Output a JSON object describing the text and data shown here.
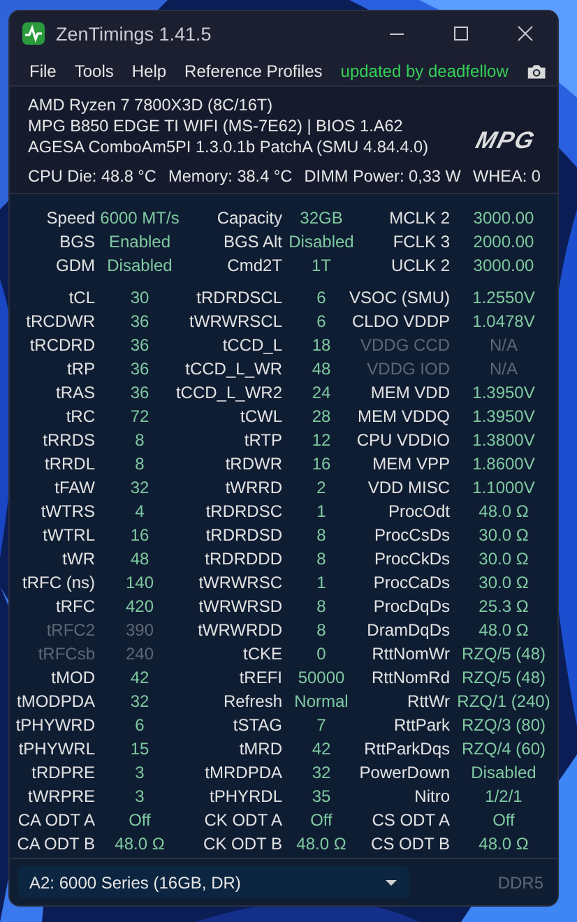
{
  "window": {
    "title": "ZenTimings 1.41.5"
  },
  "menu": {
    "items": [
      "File",
      "Tools",
      "Help",
      "Reference Profiles"
    ],
    "credit": "updated by deadfellow"
  },
  "system_info": {
    "lines": [
      "AMD Ryzen 7 7800X3D (8C/16T)",
      "MPG B850 EDGE TI WIFI (MS-7E62) | BIOS 1.A62",
      "AGESA ComboAm5PI 1.3.0.1b PatchA (SMU 4.84.4.0)"
    ],
    "logo_text": "MPG",
    "sensors": [
      "CPU Die: 48.8 °C",
      "Memory: 38.4 °C",
      "DIMM Power: 0,33 W",
      "WHEA: 0"
    ]
  },
  "summary_rows": [
    [
      {
        "label": "Speed",
        "value": "6000 MT/s",
        "disabled": false
      },
      {
        "label": "Capacity",
        "value": "32GB",
        "disabled": false
      },
      {
        "label": "MCLK  2",
        "value": "3000.00",
        "disabled": false
      }
    ],
    [
      {
        "label": "BGS",
        "value": "Enabled",
        "disabled": false
      },
      {
        "label": "BGS Alt",
        "value": "Disabled",
        "disabled": false
      },
      {
        "label": "FCLK  3",
        "value": "2000.00",
        "disabled": false
      }
    ],
    [
      {
        "label": "GDM",
        "value": "Disabled",
        "disabled": false
      },
      {
        "label": "Cmd2T",
        "value": "1T",
        "disabled": false
      },
      {
        "label": "UCLK  2",
        "value": "3000.00",
        "disabled": false
      }
    ]
  ],
  "timing_rows": [
    [
      {
        "label": "tCL",
        "value": "30",
        "disabled": false
      },
      {
        "label": "tRDRDSCL",
        "value": "6",
        "disabled": false
      },
      {
        "label": "VSOC (SMU)",
        "value": "1.2550V",
        "disabled": false
      }
    ],
    [
      {
        "label": "tRCDWR",
        "value": "36",
        "disabled": false
      },
      {
        "label": "tWRWRSCL",
        "value": "6",
        "disabled": false
      },
      {
        "label": "CLDO VDDP",
        "value": "1.0478V",
        "disabled": false
      }
    ],
    [
      {
        "label": "tRCDRD",
        "value": "36",
        "disabled": false
      },
      {
        "label": "tCCD_L",
        "value": "18",
        "disabled": false
      },
      {
        "label": "VDDG CCD",
        "value": "N/A",
        "disabled": true
      }
    ],
    [
      {
        "label": "tRP",
        "value": "36",
        "disabled": false
      },
      {
        "label": "tCCD_L_WR",
        "value": "48",
        "disabled": false
      },
      {
        "label": "VDDG IOD",
        "value": "N/A",
        "disabled": true
      }
    ],
    [
      {
        "label": "tRAS",
        "value": "36",
        "disabled": false
      },
      {
        "label": "tCCD_L_WR2",
        "value": "24",
        "disabled": false
      },
      {
        "label": "MEM VDD",
        "value": "1.3950V",
        "disabled": false
      }
    ],
    [
      {
        "label": "tRC",
        "value": "72",
        "disabled": false
      },
      {
        "label": "tCWL",
        "value": "28",
        "disabled": false
      },
      {
        "label": "MEM VDDQ",
        "value": "1.3950V",
        "disabled": false
      }
    ],
    [
      {
        "label": "tRRDS",
        "value": "8",
        "disabled": false
      },
      {
        "label": "tRTP",
        "value": "12",
        "disabled": false
      },
      {
        "label": "CPU VDDIO",
        "value": "1.3800V",
        "disabled": false
      }
    ],
    [
      {
        "label": "tRRDL",
        "value": "8",
        "disabled": false
      },
      {
        "label": "tRDWR",
        "value": "16",
        "disabled": false
      },
      {
        "label": "MEM VPP",
        "value": "1.8600V",
        "disabled": false
      }
    ],
    [
      {
        "label": "tFAW",
        "value": "32",
        "disabled": false
      },
      {
        "label": "tWRRD",
        "value": "2",
        "disabled": false
      },
      {
        "label": "VDD MISC",
        "value": "1.1000V",
        "disabled": false
      }
    ],
    [
      {
        "label": "tWTRS",
        "value": "4",
        "disabled": false
      },
      {
        "label": "tRDRDSC",
        "value": "1",
        "disabled": false
      },
      {
        "label": "ProcOdt",
        "value": "48.0 Ω",
        "disabled": false
      }
    ],
    [
      {
        "label": "tWTRL",
        "value": "16",
        "disabled": false
      },
      {
        "label": "tRDRDSD",
        "value": "8",
        "disabled": false
      },
      {
        "label": "ProcCsDs",
        "value": "30.0 Ω",
        "disabled": false
      }
    ],
    [
      {
        "label": "tWR",
        "value": "48",
        "disabled": false
      },
      {
        "label": "tRDRDDD",
        "value": "8",
        "disabled": false
      },
      {
        "label": "ProcCkDs",
        "value": "30.0 Ω",
        "disabled": false
      }
    ],
    [
      {
        "label": "tRFC (ns)",
        "value": "140",
        "disabled": false
      },
      {
        "label": "tWRWRSC",
        "value": "1",
        "disabled": false
      },
      {
        "label": "ProcCaDs",
        "value": "30.0 Ω",
        "disabled": false
      }
    ],
    [
      {
        "label": "tRFC",
        "value": "420",
        "disabled": false
      },
      {
        "label": "tWRWRSD",
        "value": "8",
        "disabled": false
      },
      {
        "label": "ProcDqDs",
        "value": "25.3 Ω",
        "disabled": false
      }
    ],
    [
      {
        "label": "tRFC2",
        "value": "390",
        "disabled": true
      },
      {
        "label": "tWRWRDD",
        "value": "8",
        "disabled": false
      },
      {
        "label": "DramDqDs",
        "value": "48.0 Ω",
        "disabled": false
      }
    ],
    [
      {
        "label": "tRFCsb",
        "value": "240",
        "disabled": true
      },
      {
        "label": "tCKE",
        "value": "0",
        "disabled": false
      },
      {
        "label": "RttNomWr",
        "value": "RZQ/5 (48)",
        "disabled": false
      }
    ],
    [
      {
        "label": "tMOD",
        "value": "42",
        "disabled": false
      },
      {
        "label": "tREFI",
        "value": "50000",
        "disabled": false
      },
      {
        "label": "RttNomRd",
        "value": "RZQ/5 (48)",
        "disabled": false
      }
    ],
    [
      {
        "label": "tMODPDA",
        "value": "32",
        "disabled": false
      },
      {
        "label": "Refresh",
        "value": "Normal",
        "disabled": false
      },
      {
        "label": "RttWr",
        "value": "RZQ/1 (240)",
        "disabled": false
      }
    ],
    [
      {
        "label": "tPHYWRD",
        "value": "6",
        "disabled": false
      },
      {
        "label": "tSTAG",
        "value": "7",
        "disabled": false
      },
      {
        "label": "RttPark",
        "value": "RZQ/3 (80)",
        "disabled": false
      }
    ],
    [
      {
        "label": "tPHYWRL",
        "value": "15",
        "disabled": false
      },
      {
        "label": "tMRD",
        "value": "42",
        "disabled": false
      },
      {
        "label": "RttParkDqs",
        "value": "RZQ/4 (60)",
        "disabled": false
      }
    ],
    [
      {
        "label": "tRDPRE",
        "value": "3",
        "disabled": false
      },
      {
        "label": "tMRDPDA",
        "value": "32",
        "disabled": false
      },
      {
        "label": "PowerDown",
        "value": "Disabled",
        "disabled": false
      }
    ],
    [
      {
        "label": "tWRPRE",
        "value": "3",
        "disabled": false
      },
      {
        "label": "tPHYRDL",
        "value": "35",
        "disabled": false
      },
      {
        "label": "Nitro",
        "value": "1/2/1",
        "disabled": false
      }
    ],
    [
      {
        "label": "CA ODT A",
        "value": "Off",
        "disabled": false
      },
      {
        "label": "CK ODT A",
        "value": "Off",
        "disabled": false
      },
      {
        "label": "CS ODT A",
        "value": "Off",
        "disabled": false
      }
    ],
    [
      {
        "label": "CA ODT B",
        "value": "48.0 Ω",
        "disabled": false
      },
      {
        "label": "CK ODT B",
        "value": "48.0 Ω",
        "disabled": false
      },
      {
        "label": "CS ODT B",
        "value": "48.0 Ω",
        "disabled": false
      }
    ]
  ],
  "footer": {
    "module": {
      "value": "A2: 6000 Series (16GB, DR)"
    },
    "memory_type": "DDR5"
  }
}
